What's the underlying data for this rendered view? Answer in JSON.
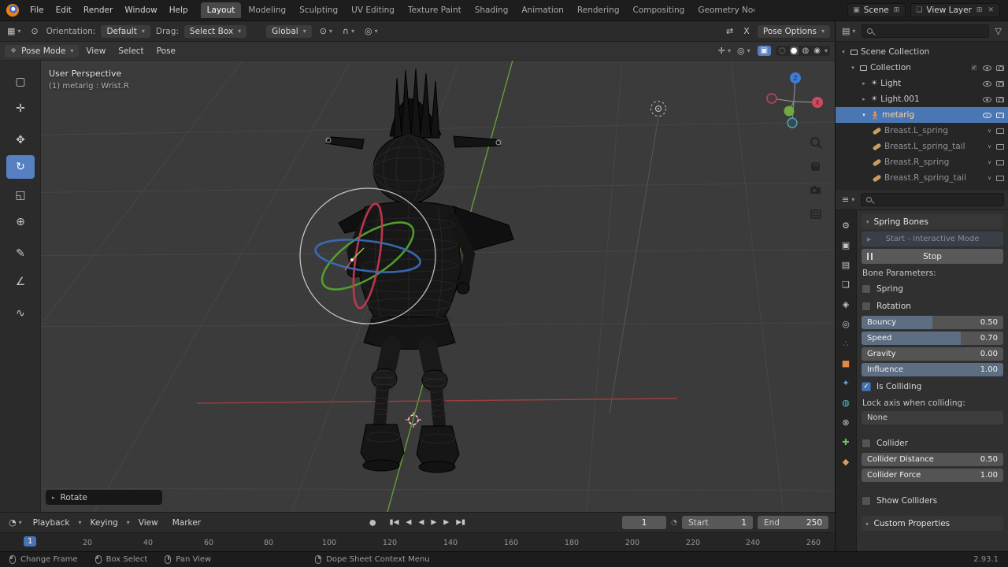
{
  "icons": {
    "dropdown": "▾",
    "collapse": "▾",
    "expand": "▸",
    "chevron": "∨",
    "mode": "❖",
    "editor_viewport": "▦",
    "editor_timeline": "◔",
    "editor_outliner": "▤",
    "editor_properties": "≡",
    "orientation_ball": "⊙",
    "pivot": "⊙",
    "snap_magnet": "∩",
    "proportional": "◎",
    "mirror": "⇄",
    "gizmo_toggle": "✛",
    "overlays_toggle": "◎",
    "xray": "▣",
    "shade_wireframe": "◌",
    "shade_solid": "●",
    "shade_material": "◍",
    "shade_rendered": "◉",
    "filter_funnel": "▽",
    "scene": "▣",
    "view_layer": "❏",
    "new": "⊞",
    "close": "✕",
    "light": "☀",
    "record": "●",
    "clock": "◔",
    "play": "▶",
    "check": "✓"
  },
  "topbar": {
    "menus": [
      "File",
      "Edit",
      "Render",
      "Window",
      "Help"
    ],
    "workspaces": [
      "Layout",
      "Modeling",
      "Sculpting",
      "UV Editing",
      "Texture Paint",
      "Shading",
      "Animation",
      "Rendering",
      "Compositing",
      "Geometry Nodes"
    ],
    "scene_label": "Scene",
    "view_layer_label": "View Layer"
  },
  "tool_settings": {
    "orientation_label": "Orientation:",
    "orientation_value": "Default",
    "drag_label": "Drag:",
    "drag_value": "Select Box",
    "transform_orientation": "Global",
    "mirror_x_label": "X",
    "pose_options_label": "Pose Options"
  },
  "viewport_header": {
    "mode": "Pose Mode",
    "menus": [
      "View",
      "Select",
      "Pose"
    ]
  },
  "tools": [
    {
      "name": "select-box",
      "glyph": "▢"
    },
    {
      "name": "cursor",
      "glyph": "✛"
    },
    {
      "name": "move",
      "glyph": "✥"
    },
    {
      "name": "rotate",
      "glyph": "↻",
      "active": true
    },
    {
      "name": "scale",
      "glyph": "◱"
    },
    {
      "name": "transform",
      "glyph": "⊕"
    },
    {
      "name": "annotate",
      "glyph": "✎"
    },
    {
      "name": "measure",
      "glyph": "∠"
    },
    {
      "name": "pose-breakdowner",
      "glyph": "∿"
    }
  ],
  "viewport": {
    "view_label": "User Perspective",
    "context_label": "(1) metarig : Wrist.R",
    "operator_label": "Rotate",
    "axis_labels": {
      "x": "X",
      "z": "Z"
    }
  },
  "outliner": {
    "rows": [
      {
        "name": "Scene Collection"
      },
      {
        "name": "Collection"
      },
      {
        "name": "Light"
      },
      {
        "name": "Light.001"
      },
      {
        "name": "metarig"
      },
      {
        "name": "Breast.L_spring"
      },
      {
        "name": "Breast.L_spring_tail"
      },
      {
        "name": "Breast.R_spring"
      },
      {
        "name": "Breast.R_spring_tail"
      }
    ]
  },
  "properties": {
    "tabs": [
      {
        "name": "tool",
        "glyph": "⚙",
        "color": "#c6c6c6"
      },
      {
        "name": "render",
        "glyph": "▣",
        "color": "#c6c6c6"
      },
      {
        "name": "output",
        "glyph": "▤",
        "color": "#c6c6c6"
      },
      {
        "name": "view-layer",
        "glyph": "❏",
        "color": "#c6c6c6"
      },
      {
        "name": "scene",
        "glyph": "◈",
        "color": "#c6c6c6"
      },
      {
        "name": "world",
        "glyph": "◎",
        "color": "#c6c6c6"
      },
      {
        "name": "particles",
        "glyph": "∴",
        "color": "#c75c5c"
      },
      {
        "name": "object",
        "glyph": "■",
        "color": "#e08a46"
      },
      {
        "name": "modifiers",
        "glyph": "✦",
        "color": "#6f9fd8"
      },
      {
        "name": "physics",
        "glyph": "◍",
        "color": "#5fb7c9"
      },
      {
        "name": "constraints",
        "glyph": "⊗",
        "color": "#c6c6c6"
      },
      {
        "name": "object-data",
        "glyph": "✚",
        "color": "#6fbf5f"
      },
      {
        "name": "bone",
        "glyph": "◆",
        "color": "#d79c66"
      }
    ],
    "panel_title": "Spring Bones",
    "start_button": "Start - Interactive Mode",
    "stop_button": "Stop",
    "bone_parameters_label": "Bone Parameters:",
    "spring_label": "Spring",
    "rotation_label": "Rotation",
    "sliders": [
      {
        "label": "Bouncy",
        "value": "0.50",
        "fraction": 0.5
      },
      {
        "label": "Speed",
        "value": "0.70",
        "fraction": 0.7
      },
      {
        "label": "Gravity",
        "value": "0.00",
        "fraction": 0
      },
      {
        "label": "Influence",
        "value": "1.00",
        "fraction": 1
      }
    ],
    "is_colliding_label": "Is Colliding",
    "lock_axis_label": "Lock axis when colliding:",
    "lock_axis_value": "None",
    "collider_label": "Collider",
    "collider_distance_label": "Collider Distance",
    "collider_distance_value": "0.50",
    "collider_force_label": "Collider Force",
    "collider_force_value": "1.00",
    "show_colliders_label": "Show Colliders",
    "custom_properties_label": "Custom Properties"
  },
  "timeline": {
    "menus": [
      "Playback",
      "Keying",
      "View",
      "Marker"
    ],
    "transport": [
      "▮◀",
      "◀",
      "◀",
      "▶",
      "▶",
      "▶▮"
    ],
    "current_frame": "1",
    "start_label": "Start",
    "start_value": "1",
    "end_label": "End",
    "end_value": "250",
    "playhead": "1",
    "ruler": [
      "20",
      "40",
      "60",
      "80",
      "100",
      "120",
      "140",
      "160",
      "180",
      "200",
      "220",
      "240",
      "260"
    ]
  },
  "status_bar": {
    "hints": [
      "Change Frame",
      "Box Select",
      "Pan View",
      "Dope Sheet Context Menu"
    ],
    "version": "2.93.1"
  },
  "colors": {
    "accent": "#4772b3",
    "tool_active": "#5680c2",
    "axis_green": "#639e36",
    "axis_red": "#9e4040",
    "selected_row": "#4a77b4",
    "selected_text": "#ffd0a4"
  }
}
